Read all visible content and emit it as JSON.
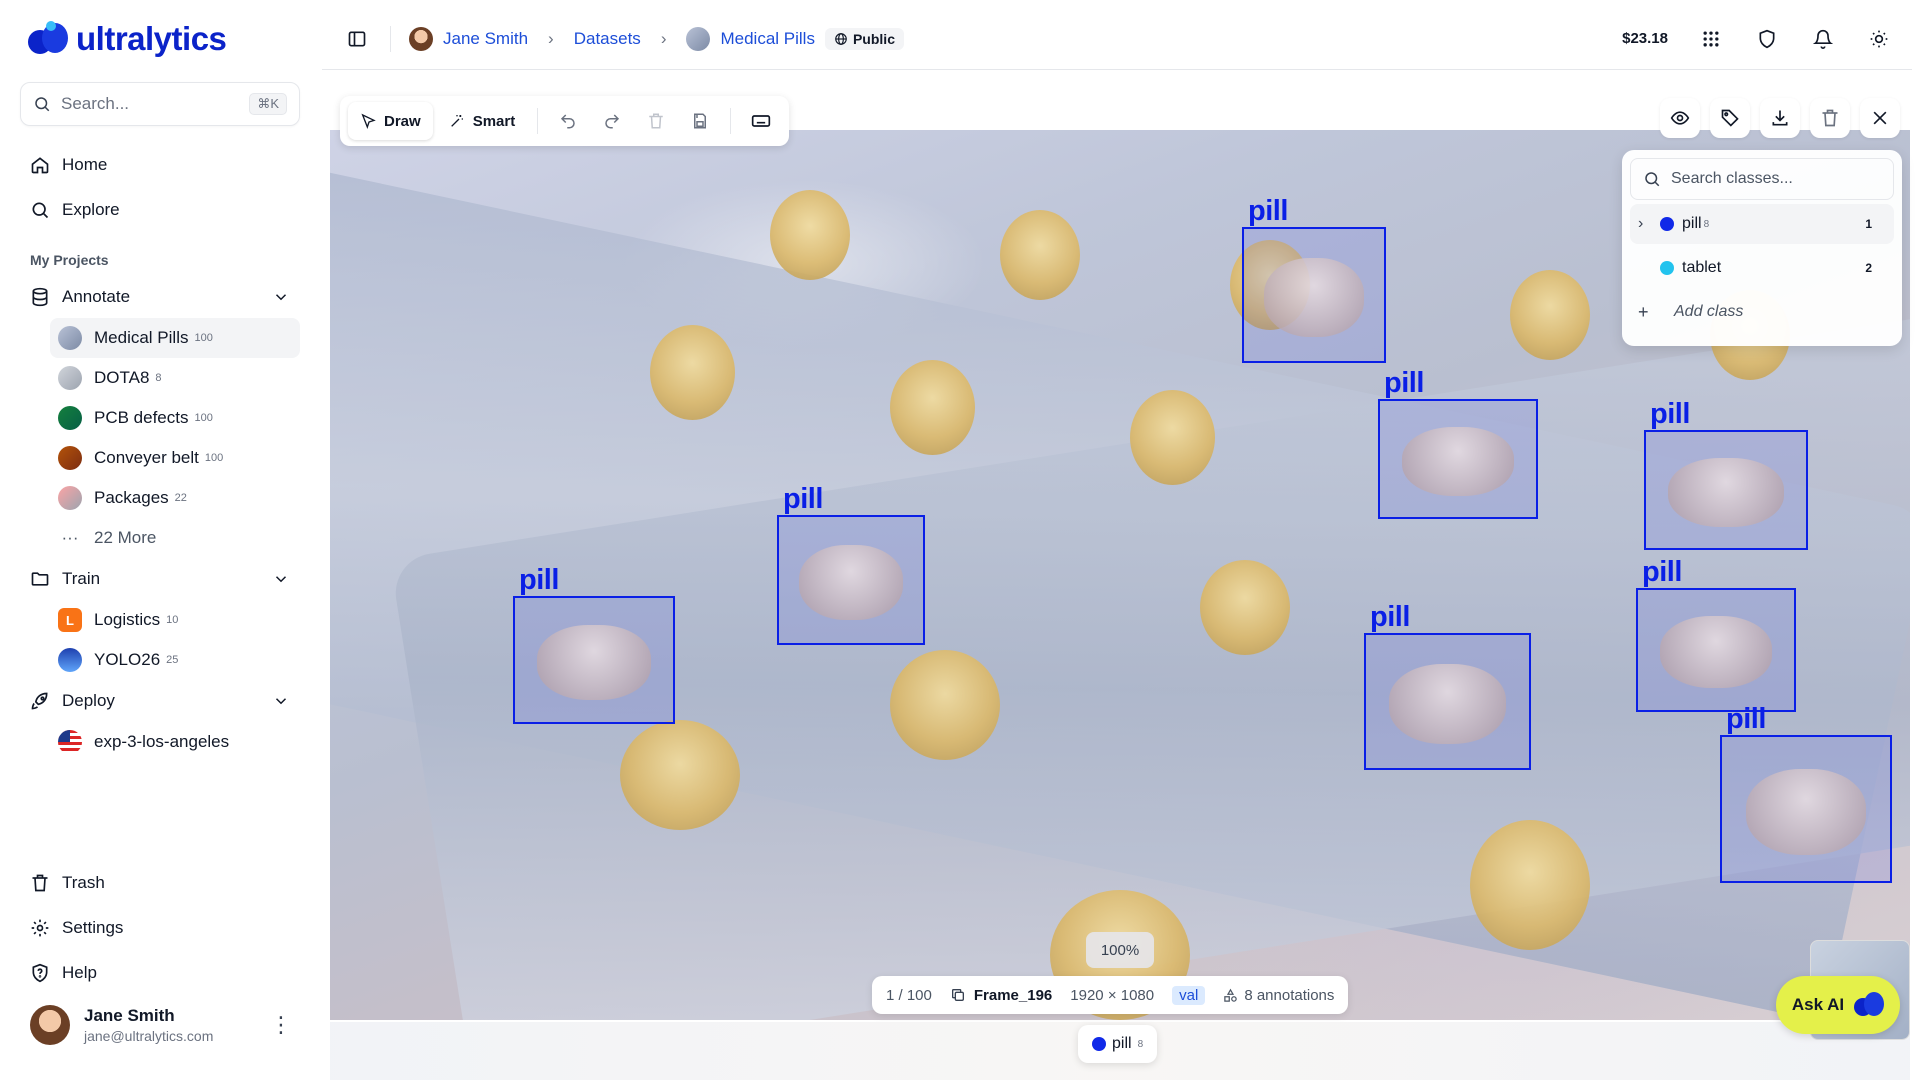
{
  "brand": {
    "name": "ultralytics"
  },
  "sidebar": {
    "search_placeholder": "Search...",
    "search_shortcut": "⌘K",
    "nav": [
      {
        "label": "Home",
        "icon": "home-icon"
      },
      {
        "label": "Explore",
        "icon": "search-icon"
      }
    ],
    "projects_label": "My Projects",
    "annotate": {
      "label": "Annotate",
      "items": [
        {
          "label": "Medical Pills",
          "count": "100"
        },
        {
          "label": "DOTA8",
          "count": "8"
        },
        {
          "label": "PCB defects",
          "count": "100"
        },
        {
          "label": "Conveyer belt",
          "count": "100"
        },
        {
          "label": "Packages",
          "count": "22"
        }
      ],
      "more": "22 More"
    },
    "train": {
      "label": "Train",
      "items": [
        {
          "label": "Logistics",
          "count": "10",
          "initial": "L"
        },
        {
          "label": "YOLO26",
          "count": "25"
        }
      ]
    },
    "deploy": {
      "label": "Deploy",
      "items": [
        {
          "label": "exp-3-los-angeles"
        }
      ]
    },
    "bottom": [
      {
        "label": "Trash",
        "icon": "trash-icon"
      },
      {
        "label": "Settings",
        "icon": "gear-icon"
      },
      {
        "label": "Help",
        "icon": "help-icon"
      }
    ],
    "user": {
      "name": "Jane Smith",
      "email": "jane@ultralytics.com"
    }
  },
  "topbar": {
    "breadcrumb": {
      "user": "Jane Smith",
      "section": "Datasets",
      "dataset": "Medical Pills"
    },
    "visibility": "Public",
    "balance": "$23.18"
  },
  "toolbar": {
    "draw": "Draw",
    "smart": "Smart"
  },
  "classes": {
    "search_placeholder": "Search classes...",
    "items": [
      {
        "name": "pill",
        "sup": "8",
        "index": "1",
        "color": "#1029e8"
      },
      {
        "name": "tablet",
        "sup": "",
        "index": "2",
        "color": "#22c3ee"
      }
    ],
    "add_label": "Add class"
  },
  "annotations": {
    "label": "pill",
    "color": "#0a1fe6",
    "count": 8
  },
  "status": {
    "zoom": "100%",
    "position": "1 / 100",
    "frame": "Frame_196",
    "resolution": "1920 × 1080",
    "split": "val",
    "annotations": "8 annotations"
  },
  "chip": {
    "label": "pill",
    "sup": "8",
    "color": "#1029e8"
  },
  "ask_ai": "Ask AI"
}
